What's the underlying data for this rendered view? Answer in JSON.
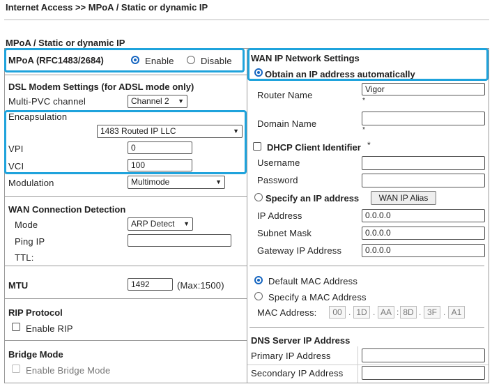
{
  "breadcrumb": "Internet Access >> MPoA / Static or dynamic IP",
  "section_title": "MPoA / Static or dynamic IP",
  "mpoa": {
    "label": "MPoA (RFC1483/2684)",
    "enable": "Enable",
    "disable": "Disable",
    "selected": "Enable"
  },
  "dsl": {
    "title": "DSL Modem Settings (for ADSL mode only)",
    "multi_pvc_label": "Multi-PVC channel",
    "multi_pvc_value": "Channel 2",
    "encapsulation_label": "Encapsulation",
    "encapsulation_value": "1483 Routed IP LLC",
    "vpi_label": "VPI",
    "vpi_value": "0",
    "vci_label": "VCI",
    "vci_value": "100",
    "modulation_label": "Modulation",
    "modulation_value": "Multimode"
  },
  "wan_detect": {
    "title": "WAN Connection Detection",
    "mode_label": "Mode",
    "mode_value": "ARP Detect",
    "ping_label": "Ping IP",
    "ping_value": "",
    "ttl_label": "TTL:"
  },
  "mtu": {
    "label": "MTU",
    "value": "1492",
    "max": "(Max:1500)"
  },
  "rip": {
    "title": "RIP Protocol",
    "enable_label": "Enable RIP"
  },
  "bridge": {
    "title": "Bridge Mode",
    "enable_label": "Enable Bridge Mode"
  },
  "wan_ip": {
    "title": "WAN IP Network Settings",
    "obtain_label": "Obtain an IP address automatically",
    "router_name_label": "Router Name",
    "router_name_value": "Vigor",
    "domain_name_label": "Domain Name",
    "domain_name_value": "",
    "star": "*",
    "dhcp_client_label": "DHCP Client Identifier",
    "username_label": "Username",
    "password_label": "Password",
    "specify_label": "Specify an IP address",
    "alias_button": "WAN IP Alias",
    "ip_label": "IP Address",
    "ip_value": "0.0.0.0",
    "subnet_label": "Subnet Mask",
    "subnet_value": "0.0.0.0",
    "gateway_label": "Gateway IP Address",
    "gateway_value": "0.0.0.0"
  },
  "mac": {
    "default_label": "Default MAC Address",
    "specify_label": "Specify a MAC Address",
    "mac_label": "MAC Address:",
    "octets": [
      "00",
      "1D",
      "AA",
      "8D",
      "3F",
      "A1"
    ],
    "separators": [
      ".",
      ".",
      ":",
      ".",
      "."
    ]
  },
  "dns": {
    "title": "DNS Server IP Address",
    "primary_label": "Primary IP Address",
    "secondary_label": "Secondary IP Address"
  }
}
